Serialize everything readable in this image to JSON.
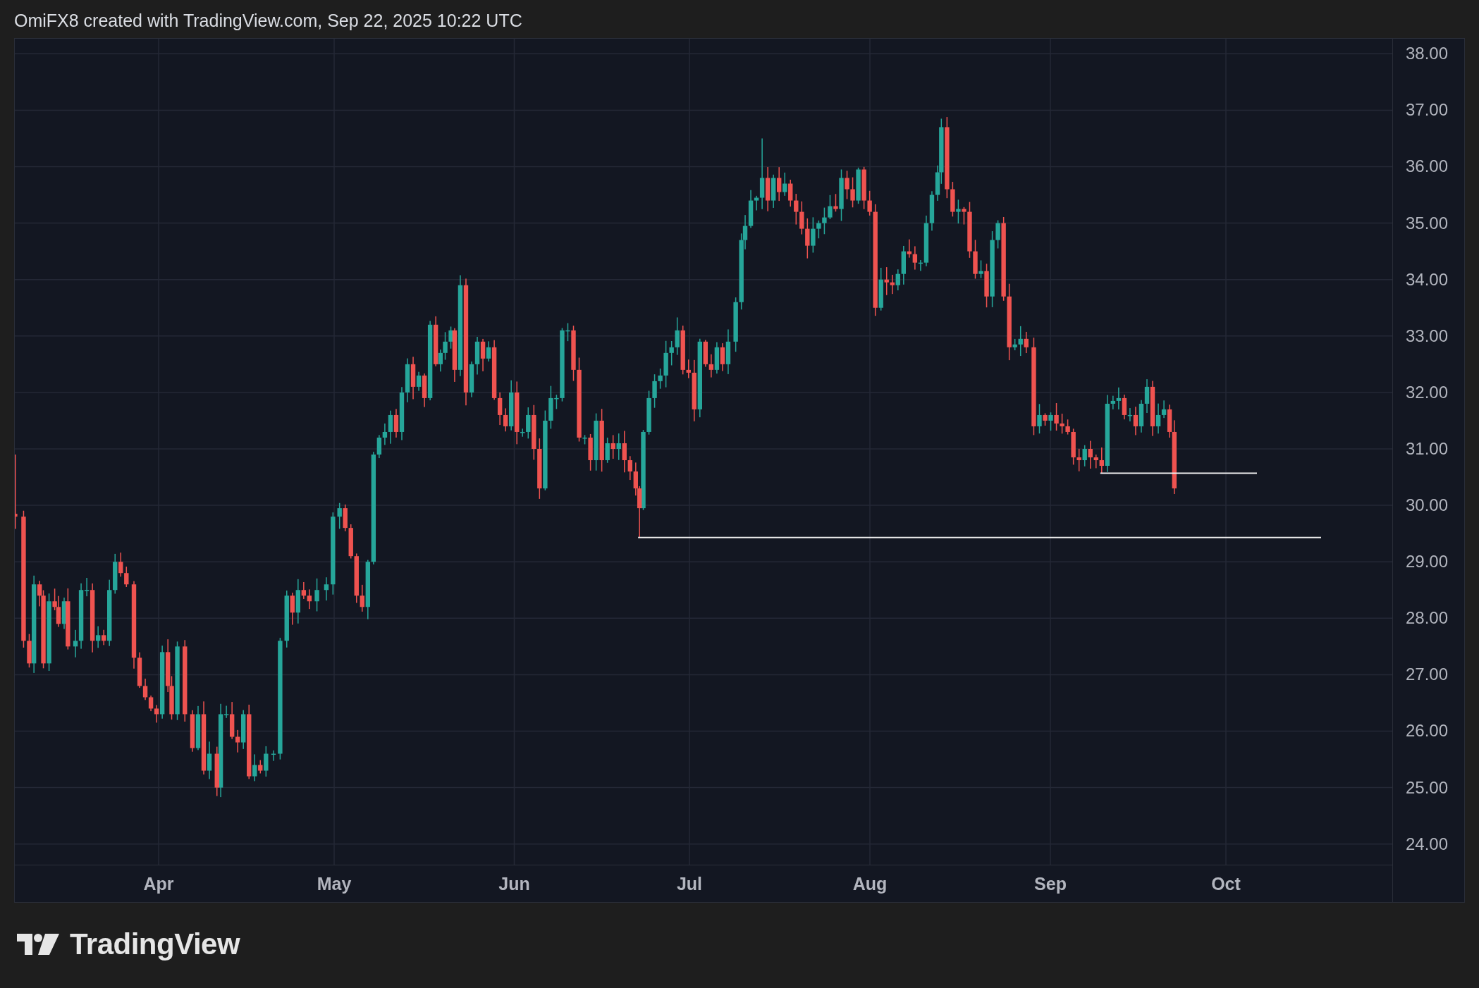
{
  "header": {
    "credit": "OmiFX8 created with TradingView.com, Sep 22, 2025 10:22 UTC"
  },
  "chart": {
    "price_labels": [
      "38.00",
      "37.00",
      "36.00",
      "35.00",
      "34.00",
      "33.00",
      "32.00",
      "31.00",
      "30.00",
      "29.00",
      "28.00",
      "27.00",
      "26.00",
      "25.00",
      "24.00"
    ],
    "month_labels": [
      "Apr",
      "May",
      "Jun",
      "Jul",
      "Aug",
      "Sep",
      "Oct"
    ]
  },
  "footer": {
    "logo_text": "TradingView"
  }
}
